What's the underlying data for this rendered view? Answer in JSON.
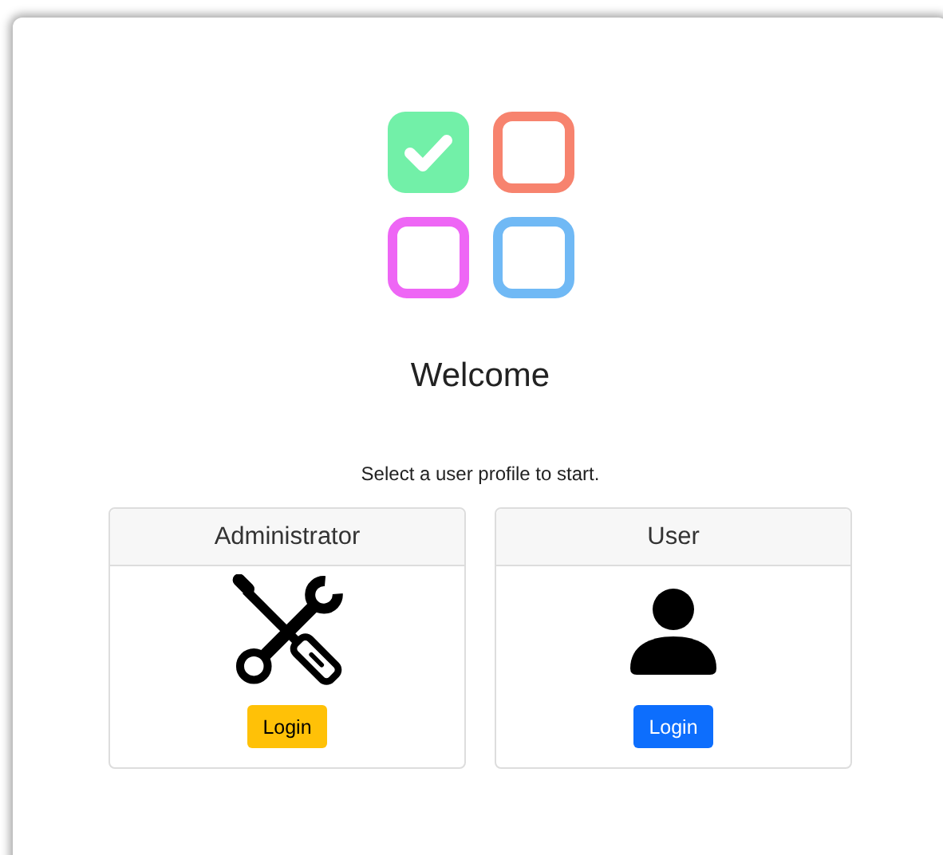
{
  "logo": {
    "tiles": [
      {
        "color": "#72f0a8",
        "checked": true
      },
      {
        "color": "#f7836e",
        "checked": false
      },
      {
        "color": "#ee66f5",
        "checked": false
      },
      {
        "color": "#70b9f5",
        "checked": false
      }
    ]
  },
  "title": "Welcome",
  "subtitle": "Select a user profile to start.",
  "profiles": [
    {
      "kind": "admin",
      "name": "Administrator",
      "button": "Login"
    },
    {
      "kind": "user",
      "name": "User",
      "button": "Login"
    }
  ]
}
